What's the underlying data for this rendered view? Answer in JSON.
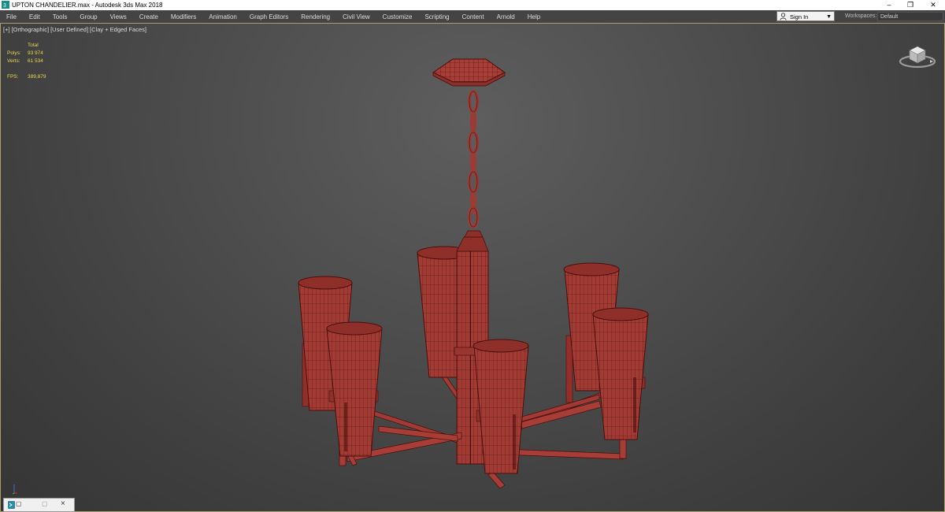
{
  "window": {
    "title": "UPTON CHANDELIER.max - Autodesk 3ds Max 2018",
    "minimize_glyph": "–",
    "restore_glyph": "❐",
    "close_glyph": "✕"
  },
  "menubar": {
    "items": [
      "File",
      "Edit",
      "Tools",
      "Group",
      "Views",
      "Create",
      "Modifiers",
      "Animation",
      "Graph Editors",
      "Rendering",
      "Civil View",
      "Customize",
      "Scripting",
      "Content",
      "Arnold",
      "Help"
    ],
    "signin_label": "Sign In",
    "workspaces_label": "Workspaces:",
    "workspace_value": "Default"
  },
  "viewport": {
    "labels": [
      "[+]",
      "[Orthographic]",
      "[User Defined]",
      "[Clay + Edged Faces]"
    ],
    "stats": {
      "header": "Total",
      "polys_label": "Polys:",
      "polys_value": "93 974",
      "verts_label": "Verts:",
      "verts_value": "61 534",
      "fps_label": "FPS:",
      "fps_value": "389,879"
    }
  },
  "colors": {
    "model_fill": "#9e3a34",
    "model_wire": "#4a0f0c",
    "stats_text": "#e6d84a",
    "viewport_border": "#a8a06b"
  },
  "icons": {
    "app": "3dsmax-app-icon",
    "user": "user-icon",
    "viewcube": "viewcube-icon",
    "axis": "axis-tripod-icon"
  }
}
